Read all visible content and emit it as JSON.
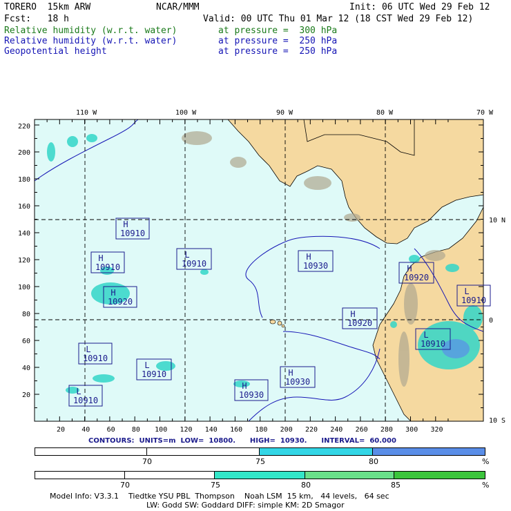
{
  "header": {
    "model": "TORERO  15km ARW",
    "org": "NCAR/MMM",
    "init": "Init: 06 UTC Wed 29 Feb 12",
    "fcst": "Fcst:   18 h",
    "valid": "Valid: 00 UTC Thu 01 Mar 12 (18 CST Wed 29 Feb 12)"
  },
  "fields": [
    {
      "name": "Relative humidity (w.r.t. water)",
      "level": "at pressure =  300 hPa",
      "color": "#1a7a1a"
    },
    {
      "name": "Relative humidity (w.r.t. water)",
      "level": "at pressure =  250 hPa",
      "color": "#1515b5"
    },
    {
      "name": "Geopotential height",
      "level": "at pressure =  250 hPa",
      "color": "#1515b5"
    }
  ],
  "axes": {
    "top_lon": [
      "110 W",
      "100 W",
      "90 W",
      "80 W",
      "70 W"
    ],
    "right_lat": [
      "10 N",
      "0",
      "10 S"
    ],
    "left_y": [
      "220",
      "200",
      "180",
      "160",
      "140",
      "120",
      "100",
      "80",
      "60",
      "40",
      "20"
    ],
    "bottom_x": [
      "20",
      "40",
      "60",
      "80",
      "100",
      "120",
      "140",
      "160",
      "180",
      "200",
      "220",
      "240",
      "260",
      "280",
      "300",
      "320"
    ]
  },
  "pressure_centers": [
    {
      "type": "H",
      "value": "10910"
    },
    {
      "type": "H",
      "value": "10910"
    },
    {
      "type": "L",
      "value": "10910"
    },
    {
      "type": "H",
      "value": "10930"
    },
    {
      "type": "H",
      "value": "10920"
    },
    {
      "type": "H",
      "value": "10920"
    },
    {
      "type": "L",
      "value": "10910"
    },
    {
      "type": "H",
      "value": "10920"
    },
    {
      "type": "L",
      "value": "10910"
    },
    {
      "type": "L",
      "value": "10910"
    },
    {
      "type": "H",
      "value": "10930"
    },
    {
      "type": "L",
      "value": "10910"
    },
    {
      "type": "H",
      "value": "10930"
    },
    {
      "type": "L",
      "value": "10910"
    }
  ],
  "contour_info": "CONTOURS:  UNITS=m  LOW=  10800.      HIGH=  10930.      INTERVAL=  60.000",
  "colorbar_250": {
    "labels": [
      "70",
      "75",
      "80"
    ],
    "unit": "%",
    "colors": [
      "#ffffff",
      "#ffffff",
      "#33d6e6",
      "#5a8ee8"
    ]
  },
  "colorbar_300": {
    "labels": [
      "70",
      "75",
      "80",
      "85"
    ],
    "unit": "%",
    "colors": [
      "#ffffff",
      "#ffffff",
      "#33e6c8",
      "#6ae08a",
      "#3cc43c"
    ]
  },
  "footer": {
    "line1": "Model Info: V3.3.1    Tiedtke YSU PBL  Thompson    Noah LSM  15 km,   44 levels,   64 sec",
    "line2": "LW: Godd SW: Goddard DIFF: simple KM: 2D Smagor"
  }
}
